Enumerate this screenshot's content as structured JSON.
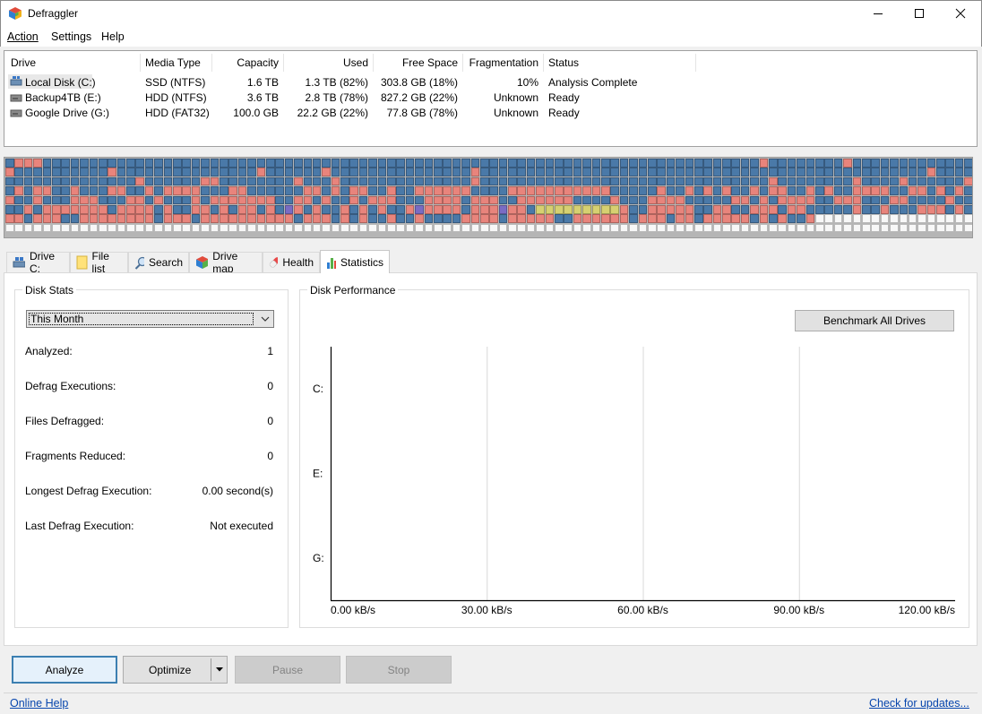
{
  "window": {
    "title": "Defraggler"
  },
  "menu": [
    "Action",
    "Settings",
    "Help"
  ],
  "drive_table": {
    "columns": [
      "Drive",
      "Media Type",
      "Capacity",
      "Used",
      "Free Space",
      "Fragmentation",
      "Status"
    ],
    "rows": [
      {
        "drive": "Local Disk (C:)",
        "media": "SSD (NTFS)",
        "capacity": "1.6 TB",
        "used": "1.3 TB (82%)",
        "free": "303.8 GB (18%)",
        "frag": "10%",
        "status": "Analysis Complete",
        "selected": true
      },
      {
        "drive": "Backup4TB (E:)",
        "media": "HDD (NTFS)",
        "capacity": "3.6 TB",
        "used": "2.8 TB (78%)",
        "free": "827.2 GB (22%)",
        "frag": "Unknown",
        "status": "Ready",
        "selected": false
      },
      {
        "drive": "Google Drive (G:)",
        "media": "HDD (FAT32)",
        "capacity": "100.0 GB",
        "used": "22.2 GB (22%)",
        "free": "77.8 GB (78%)",
        "frag": "Unknown",
        "status": "Ready",
        "selected": false
      }
    ]
  },
  "drive_map": {
    "colors": {
      "used": "#4a79a8",
      "fragmented": "#e8847c",
      "free": "#f7f7f7",
      "system": "#7a6cc4",
      "compressed": "#d6d071"
    }
  },
  "tabs": [
    {
      "label": "Drive C:",
      "icon": "drive-icon"
    },
    {
      "label": "File list",
      "icon": "folder-icon"
    },
    {
      "label": "Search",
      "icon": "search-icon"
    },
    {
      "label": "Drive map",
      "icon": "drive-map-icon"
    },
    {
      "label": "Health",
      "icon": "health-icon"
    },
    {
      "label": "Statistics",
      "icon": "statistics-icon",
      "active": true
    }
  ],
  "disk_stats": {
    "title": "Disk Stats",
    "period": "This Month",
    "items": [
      {
        "label": "Analyzed:",
        "value": "1"
      },
      {
        "label": "Defrag Executions:",
        "value": "0"
      },
      {
        "label": "Files Defragged:",
        "value": "0"
      },
      {
        "label": "Fragments Reduced:",
        "value": "0"
      },
      {
        "label": "Longest Defrag Execution:",
        "value": "0.00 second(s)"
      },
      {
        "label": "Last Defrag Execution:",
        "value": "Not executed"
      }
    ]
  },
  "disk_performance": {
    "title": "Disk Performance",
    "benchmark_label": "Benchmark All Drives"
  },
  "chart_data": {
    "type": "bar",
    "orientation": "horizontal",
    "categories": [
      "C:",
      "E:",
      "G:"
    ],
    "values": [
      null,
      null,
      null
    ],
    "x_ticks": [
      "0.00 kB/s",
      "30.00 kB/s",
      "60.00 kB/s",
      "90.00 kB/s",
      "120.00 kB/s"
    ],
    "xlim": [
      0,
      120
    ],
    "grid": true
  },
  "buttons": {
    "analyze": "Analyze",
    "optimize": "Optimize",
    "pause": "Pause",
    "stop": "Stop"
  },
  "footer": {
    "online_help": "Online Help",
    "check_updates": "Check for updates..."
  }
}
